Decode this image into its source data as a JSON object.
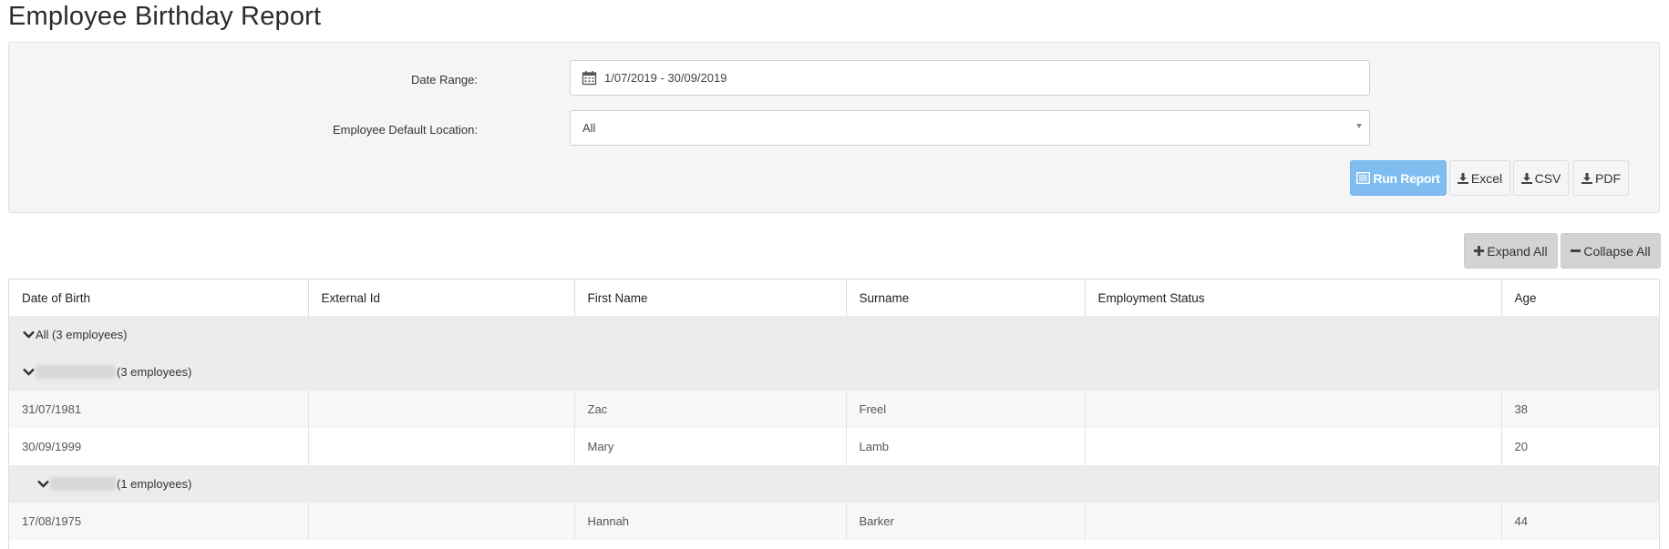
{
  "page": {
    "title": "Employee Birthday Report"
  },
  "filters": {
    "date_range_label": "Date Range:",
    "date_range_value": "1/07/2019 - 30/09/2019",
    "location_label": "Employee Default Location:",
    "location_value": "All"
  },
  "actions": {
    "run_report": "Run Report",
    "excel": "Excel",
    "csv": "CSV",
    "pdf": "PDF",
    "expand_all": "Expand All",
    "collapse_all": "Collapse All"
  },
  "table": {
    "headers": [
      "Date of Birth",
      "External Id",
      "First Name",
      "Surname",
      "Employment Status",
      "Age"
    ],
    "group_all": "All (3 employees)",
    "group_1_count": "(3 employees)",
    "group_2_count": "(1 employees)",
    "rows": [
      {
        "dob": "31/07/1981",
        "external_id": "",
        "first_name": "Zac",
        "surname": "Freel",
        "status": "",
        "age": "38"
      },
      {
        "dob": "30/09/1999",
        "external_id": "",
        "first_name": "Mary",
        "surname": "Lamb",
        "status": "",
        "age": "20"
      },
      {
        "dob": "17/08/1975",
        "external_id": "",
        "first_name": "Hannah",
        "surname": "Barker",
        "status": "",
        "age": "44"
      }
    ]
  },
  "icons": {
    "calendar": "calendar-icon",
    "run": "list-icon",
    "download": "download-icon",
    "plus": "plus-icon",
    "minus": "minus-icon",
    "chevron": "chevron-down-icon"
  }
}
